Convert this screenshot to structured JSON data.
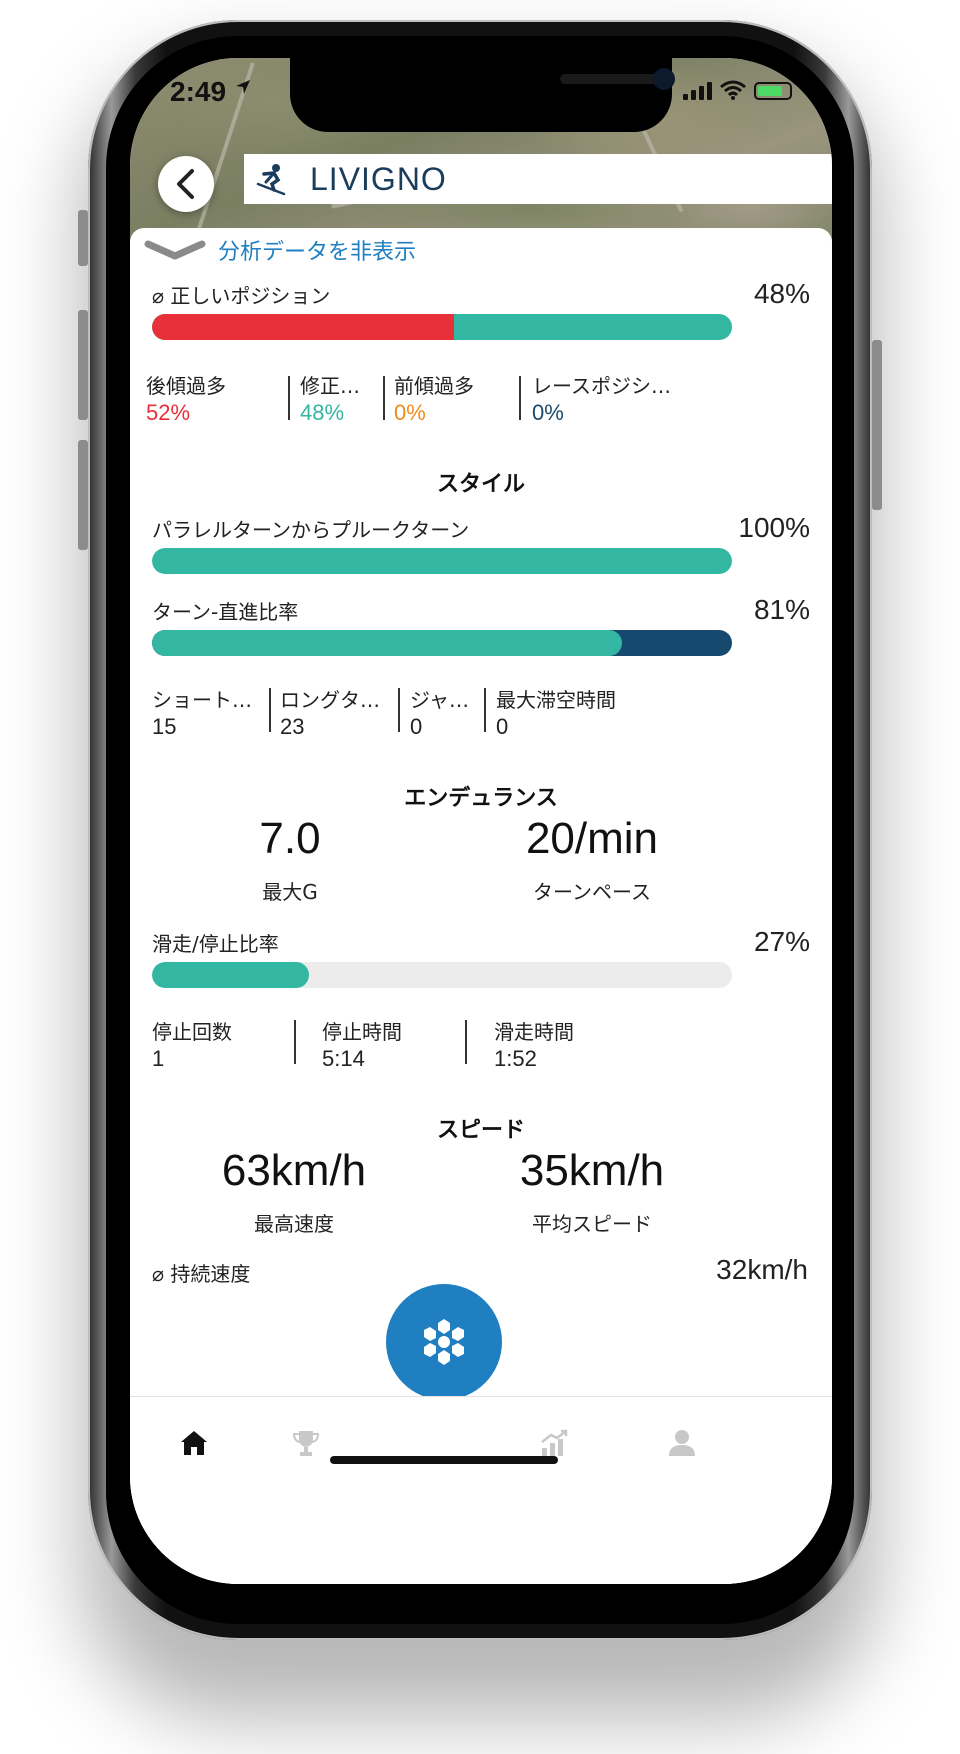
{
  "status": {
    "time": "2:49"
  },
  "header": {
    "title": "LIVIGNO"
  },
  "collapse_label": "分析データを非表示",
  "position": {
    "label": "⌀ 正しいポジション",
    "percent": "48%",
    "value": 0.48,
    "stats": [
      {
        "label": "後傾過多",
        "value": "52%",
        "color": "#e8303a"
      },
      {
        "label": "修正…",
        "value": "48%",
        "color": "#33b6a2"
      },
      {
        "label": "前傾過多",
        "value": "0%",
        "color": "#f08a1c"
      },
      {
        "label": "レースポジシ…",
        "value": "0%",
        "color": "#1a4a6e"
      }
    ]
  },
  "style": {
    "title": "スタイル",
    "parallel": {
      "label": "パラレルターンからプルークターン",
      "percent": "100%",
      "value": 1.0
    },
    "turn_ratio": {
      "label": "ターン-直進比率",
      "percent": "81%",
      "value": 0.81
    },
    "stats": [
      {
        "label": "ショート…",
        "value": "15"
      },
      {
        "label": "ロングタ…",
        "value": "23"
      },
      {
        "label": "ジャ…",
        "value": "0"
      },
      {
        "label": "最大滞空時間",
        "value": "0"
      }
    ]
  },
  "endurance": {
    "title": "エンデュランス",
    "max_g": {
      "value": "7.0",
      "label": "最大G"
    },
    "turn_pace": {
      "value": "20/min",
      "label": "ターンペース"
    },
    "ride_ratio": {
      "label": "滑走/停止比率",
      "percent": "27%",
      "value": 0.27
    },
    "stats": [
      {
        "label": "停止回数",
        "value": "1"
      },
      {
        "label": "停止時間",
        "value": "5:14"
      },
      {
        "label": "滑走時間",
        "value": "1:52"
      }
    ]
  },
  "speed": {
    "title": "スピード",
    "max": {
      "value": "63km/h",
      "label": "最高速度"
    },
    "avg": {
      "value": "35km/h",
      "label": "平均スピード"
    },
    "sustained": {
      "label": "⌀ 持続速度",
      "value": "32km/h"
    }
  },
  "colors": {
    "red": "#e8303a",
    "teal": "#33b6a2",
    "navy": "#154a6e",
    "blue": "#1f7fc0",
    "track": "#ececec"
  },
  "icons": [
    "back-arrow-icon",
    "skier-icon",
    "chevron-down-icon",
    "snowflake-icon",
    "home-icon",
    "trophy-icon",
    "stats-icon",
    "profile-icon"
  ]
}
